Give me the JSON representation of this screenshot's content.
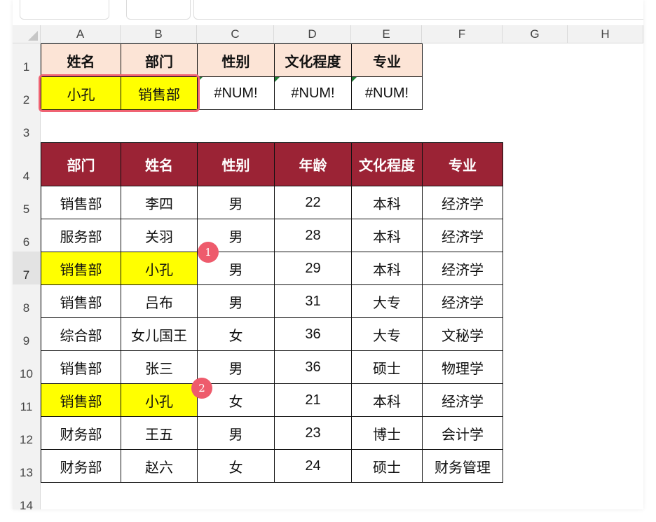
{
  "columns": [
    "A",
    "B",
    "C",
    "D",
    "E",
    "F",
    "G",
    "H"
  ],
  "rows": [
    "1",
    "2",
    "3",
    "4",
    "5",
    "6",
    "7",
    "8",
    "9",
    "10",
    "11",
    "12",
    "13",
    "14"
  ],
  "lookup_table": {
    "headers": [
      "姓名",
      "部门",
      "性别",
      "文化程度",
      "专业"
    ],
    "values": [
      "小孔",
      "销售部",
      "#NUM!",
      "#NUM!",
      "#NUM!"
    ]
  },
  "data_table": {
    "headers": [
      "部门",
      "姓名",
      "性别",
      "年龄",
      "文化程度",
      "专业"
    ],
    "rows": [
      [
        "销售部",
        "李四",
        "男",
        "22",
        "本科",
        "经济学"
      ],
      [
        "服务部",
        "关羽",
        "男",
        "28",
        "本科",
        "经济学"
      ],
      [
        "销售部",
        "小孔",
        "男",
        "29",
        "本科",
        "经济学"
      ],
      [
        "销售部",
        "吕布",
        "男",
        "31",
        "大专",
        "经济学"
      ],
      [
        "综合部",
        "女儿国王",
        "女",
        "36",
        "大专",
        "文秘学"
      ],
      [
        "销售部",
        "张三",
        "男",
        "36",
        "硕士",
        "物理学"
      ],
      [
        "销售部",
        "小孔",
        "女",
        "21",
        "本科",
        "经济学"
      ],
      [
        "财务部",
        "王五",
        "男",
        "23",
        "博士",
        "会计学"
      ],
      [
        "财务部",
        "赵六",
        "女",
        "24",
        "硕士",
        "财务管理"
      ]
    ]
  },
  "badges": [
    "1",
    "2"
  ],
  "colors": {
    "header_peach": "#fce4d6",
    "header_red": "#9b2335",
    "highlight_yellow": "#ffff00",
    "annotation_red": "#ee5b6c"
  }
}
